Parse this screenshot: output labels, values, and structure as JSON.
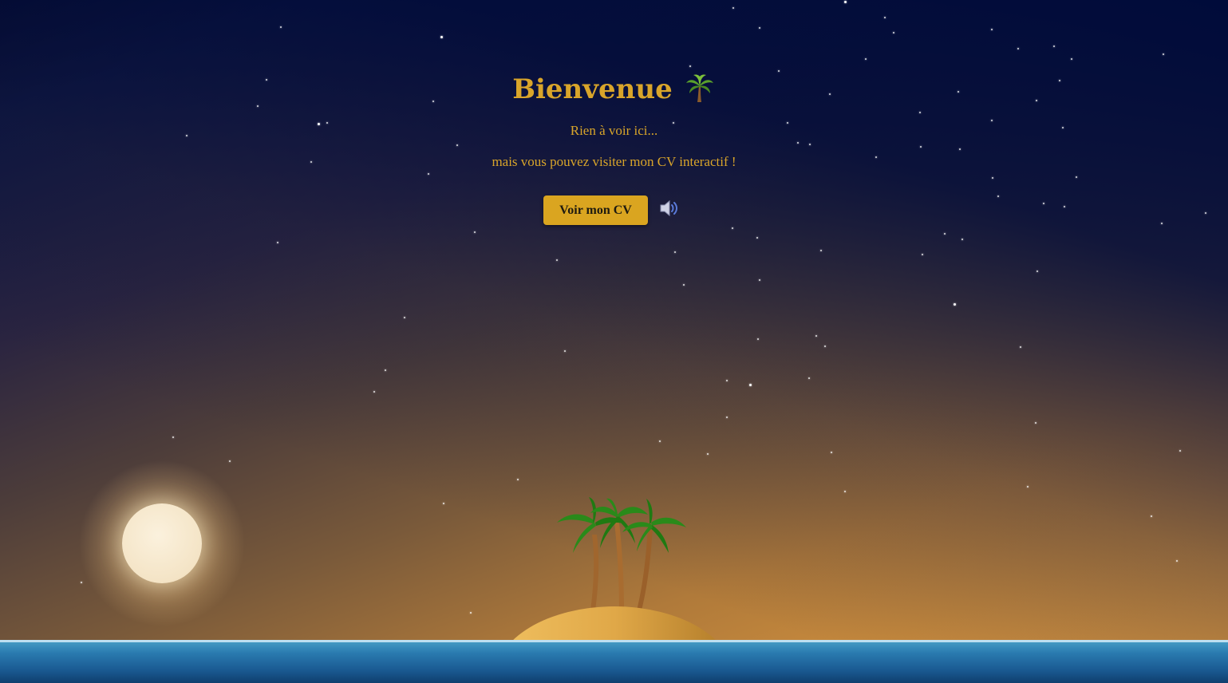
{
  "page": {
    "title": "Bienvenue",
    "title_icon": "palm-tree-emoji",
    "subtitle_line1": "Rien à voir ici...",
    "subtitle_line2": "mais vous pouvez visiter mon CV interactif !",
    "cv_button_label": "Voir mon CV",
    "sound_icon": "speaker-volume-icon"
  },
  "colors": {
    "accent": "#daa520",
    "text_gold": "#d9a52a",
    "sky_top": "#00072d",
    "sunset": "#e8a040",
    "sea": "#2a7bb0"
  }
}
